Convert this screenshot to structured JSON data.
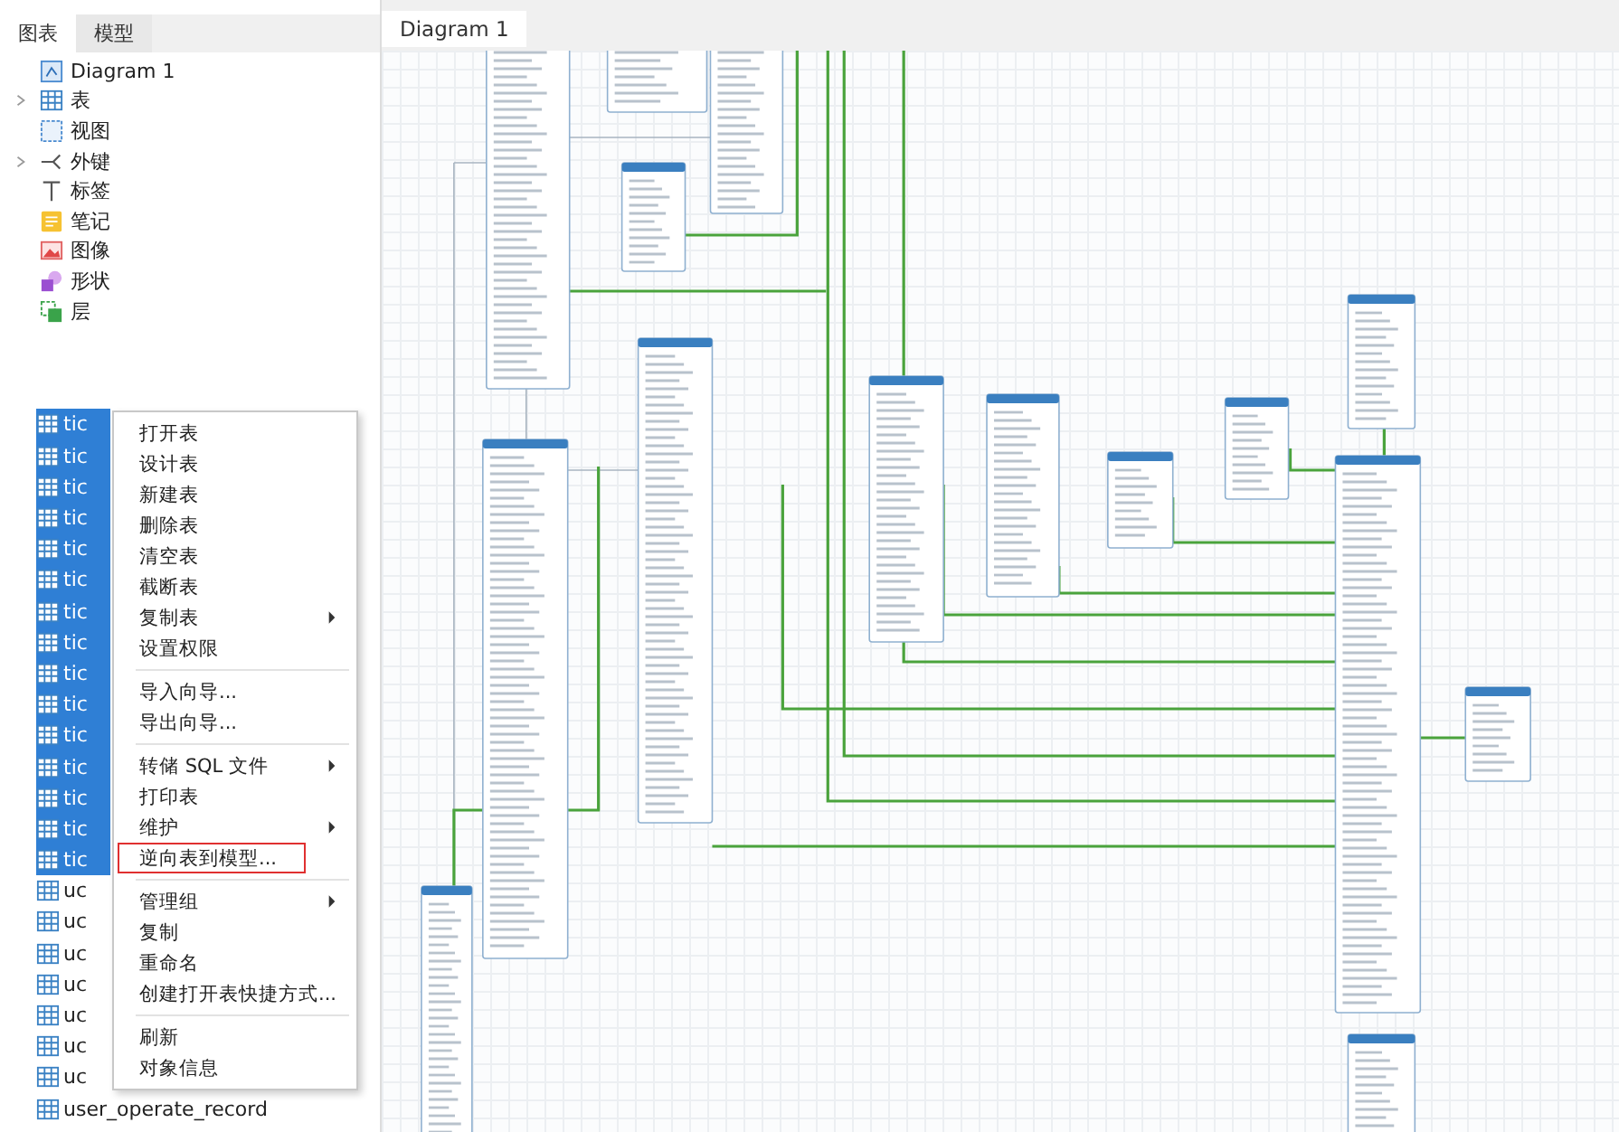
{
  "sidebar": {
    "tabs": [
      {
        "label": "图表",
        "selected": true
      },
      {
        "label": "模型",
        "selected": false
      }
    ],
    "tree": [
      {
        "label": "Diagram 1",
        "kind": "diagram"
      },
      {
        "label": "表",
        "kind": "table",
        "expanded": false
      },
      {
        "label": "视图",
        "kind": "view"
      },
      {
        "label": "外键",
        "kind": "foreign-key",
        "expanded": false
      },
      {
        "label": "标签",
        "kind": "label"
      },
      {
        "label": "笔记",
        "kind": "note"
      },
      {
        "label": "图像",
        "kind": "image"
      },
      {
        "label": "形状",
        "kind": "shape"
      },
      {
        "label": "层",
        "kind": "layer"
      }
    ],
    "object_list": [
      {
        "label": "tic",
        "selected": true
      },
      {
        "label": "tic",
        "selected": true
      },
      {
        "label": "tic",
        "selected": true
      },
      {
        "label": "tic",
        "selected": true
      },
      {
        "label": "tic",
        "selected": true
      },
      {
        "label": "tic",
        "selected": true
      },
      {
        "label": "tic",
        "selected": true
      },
      {
        "label": "tic",
        "selected": true
      },
      {
        "label": "tic",
        "selected": true
      },
      {
        "label": "tic",
        "selected": true
      },
      {
        "label": "tic",
        "selected": true
      },
      {
        "label": "tic",
        "selected": true
      },
      {
        "label": "tic",
        "selected": true
      },
      {
        "label": "tic",
        "selected": true
      },
      {
        "label": "tic",
        "selected": true
      },
      {
        "label": "uc",
        "selected": false
      },
      {
        "label": "uc",
        "selected": false
      },
      {
        "label": "uc",
        "selected": false
      },
      {
        "label": "uc",
        "selected": false
      },
      {
        "label": "uc",
        "selected": false
      },
      {
        "label": "uc",
        "selected": false
      },
      {
        "label": "uc",
        "selected": false
      },
      {
        "label": "user_operate_record",
        "selected": false
      }
    ]
  },
  "context_menu": {
    "groups": [
      [
        {
          "label": "打开表",
          "submenu": false,
          "highlighted": false
        },
        {
          "label": "设计表",
          "submenu": false,
          "highlighted": false
        },
        {
          "label": "新建表",
          "submenu": false,
          "highlighted": false
        },
        {
          "label": "删除表",
          "submenu": false,
          "highlighted": false
        },
        {
          "label": "清空表",
          "submenu": false,
          "highlighted": false
        },
        {
          "label": "截断表",
          "submenu": false,
          "highlighted": false
        },
        {
          "label": "复制表",
          "submenu": true,
          "highlighted": false
        },
        {
          "label": "设置权限",
          "submenu": false,
          "highlighted": false
        }
      ],
      [
        {
          "label": "导入向导...",
          "submenu": false,
          "highlighted": false
        },
        {
          "label": "导出向导...",
          "submenu": false,
          "highlighted": false
        }
      ],
      [
        {
          "label": "转储 SQL 文件",
          "submenu": true,
          "highlighted": false
        },
        {
          "label": "打印表",
          "submenu": false,
          "highlighted": false
        },
        {
          "label": "维护",
          "submenu": true,
          "highlighted": false
        },
        {
          "label": "逆向表到模型...",
          "submenu": false,
          "highlighted": true
        }
      ],
      [
        {
          "label": "管理组",
          "submenu": true,
          "highlighted": false
        },
        {
          "label": "复制",
          "submenu": false,
          "highlighted": false
        },
        {
          "label": "重命名",
          "submenu": false,
          "highlighted": false
        },
        {
          "label": "创建打开表快捷方式...",
          "submenu": false,
          "highlighted": false
        }
      ],
      [
        {
          "label": "刷新",
          "submenu": false,
          "highlighted": false
        },
        {
          "label": "对象信息",
          "submenu": false,
          "highlighted": false
        }
      ]
    ]
  },
  "diagram": {
    "tab": "Diagram 1"
  }
}
